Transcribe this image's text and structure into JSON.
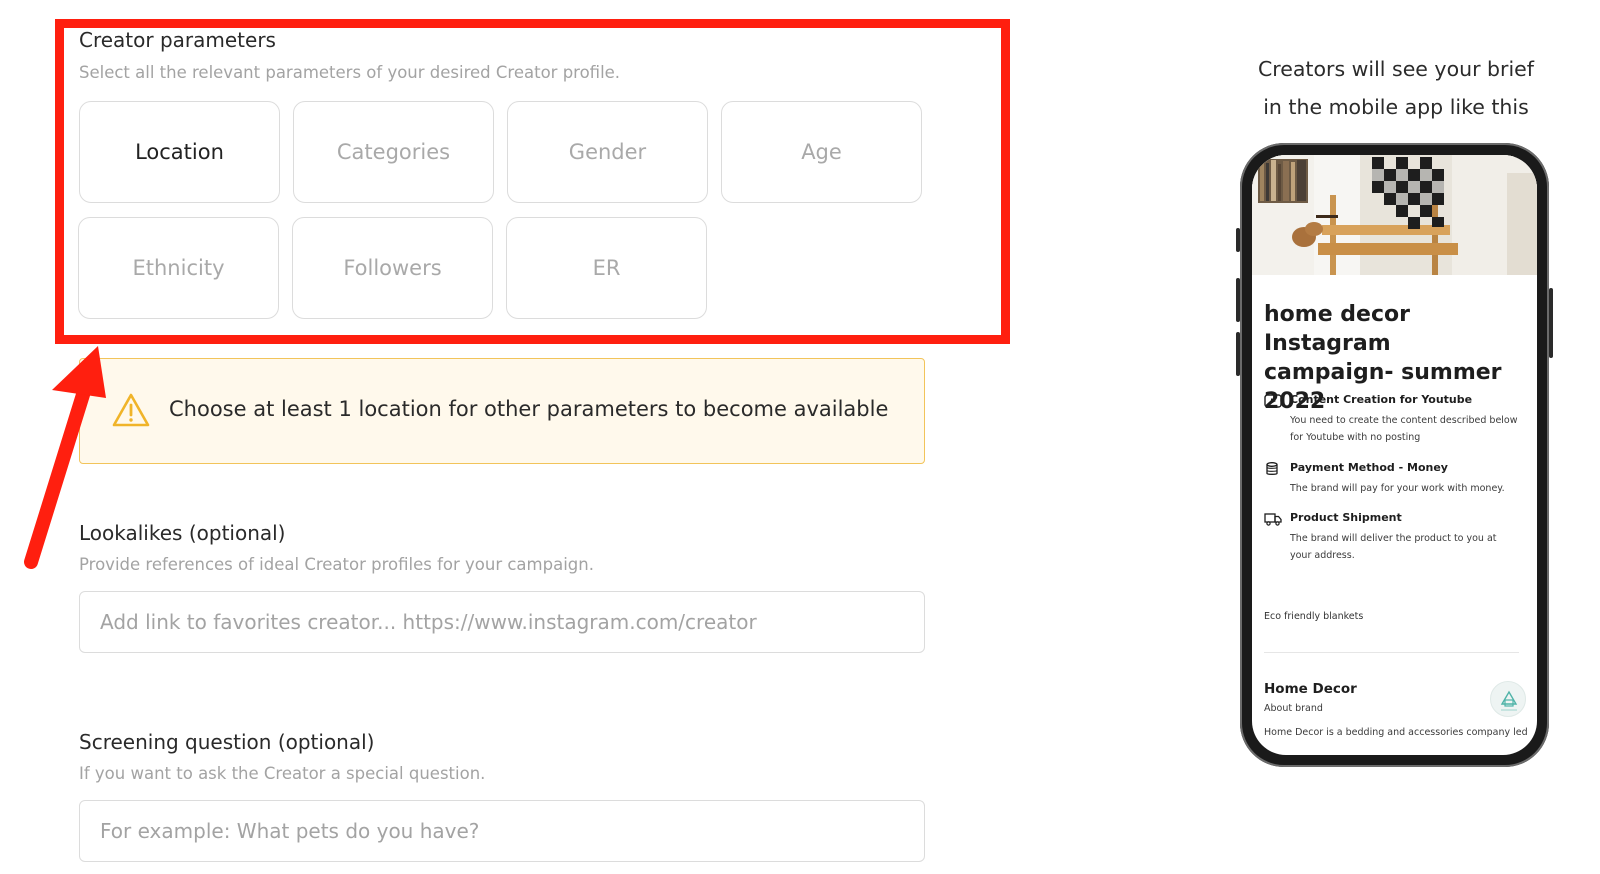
{
  "creator_params": {
    "title": "Creator parameters",
    "subtitle": "Select all the relevant parameters of your desired Creator profile.",
    "buttons": [
      "Location",
      "Categories",
      "Gender",
      "Age",
      "Ethnicity",
      "Followers",
      "ER"
    ],
    "active": "Location"
  },
  "warning": {
    "icon": "warning-triangle-icon",
    "text": "Choose at least 1 location for other parameters to become available"
  },
  "lookalikes": {
    "title": "Lookalikes",
    "optional": "(optional)",
    "subtitle": "Provide references of ideal Creator profiles for your campaign.",
    "placeholder": "Add link to favorites creator... https://www.instagram.com/creator"
  },
  "screening": {
    "title": "Screening question",
    "optional": "(optional)",
    "subtitle": "If you want to ask the Creator a special question.",
    "placeholder": "For example: What pets do you have?"
  },
  "preview": {
    "caption_line1": "Creators will see your brief",
    "caption_line2": "in the mobile app like this",
    "brief_title": "home decor Instagram campaign- summer 2022",
    "features": [
      {
        "icon": "youtube-icon",
        "title": "Content Creation for Youtube",
        "desc": "You need to create the content described below for Youtube with no posting"
      },
      {
        "icon": "coins-icon",
        "title": "Payment Method - Money",
        "desc": "The brand will pay for your work with money."
      },
      {
        "icon": "truck-icon",
        "title": "Product Shipment",
        "desc": "The brand will deliver the product to you at your address."
      }
    ],
    "eco": "Eco friendly blankets",
    "brand_name": "Home Decor",
    "about": "About brand",
    "brand_desc": "Home Decor is a bedding and accessories company led"
  },
  "colors": {
    "highlight": "#ff1f0f",
    "warning_bg": "#fff9ec",
    "warning_border": "#f2c45a",
    "warning_icon": "#f0b429"
  }
}
